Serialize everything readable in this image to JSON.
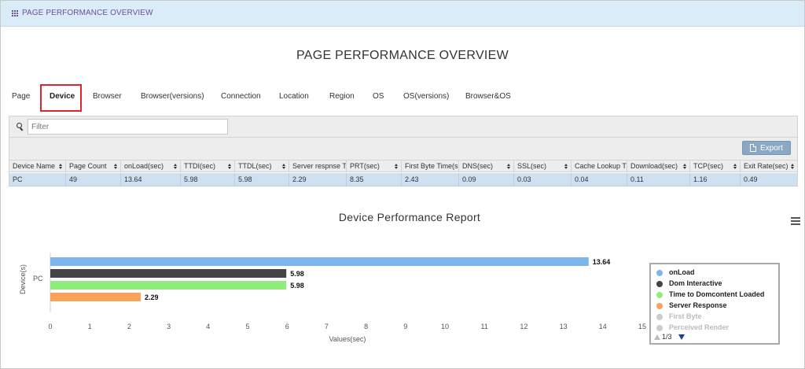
{
  "topbar": {
    "title": "PAGE PERFORMANCE OVERVIEW",
    "icon": "grid-icon"
  },
  "page_title": "PAGE PERFORMANCE OVERVIEW",
  "tabs": [
    {
      "label": "Page",
      "active": false
    },
    {
      "label": "Device",
      "active": true
    },
    {
      "label": "Browser",
      "active": false
    },
    {
      "label": "Browser(versions)",
      "active": false
    },
    {
      "label": "Connection",
      "active": false
    },
    {
      "label": "Location",
      "active": false
    },
    {
      "label": "Region",
      "active": false
    },
    {
      "label": "OS",
      "active": false
    },
    {
      "label": "OS(versions)",
      "active": false
    },
    {
      "label": "Browser&OS",
      "active": false
    }
  ],
  "filter": {
    "placeholder": "Filter",
    "value": ""
  },
  "export_label": "Export",
  "table": {
    "columns": [
      "Device Name",
      "Page Count",
      "onLoad(sec)",
      "TTDI(sec)",
      "TTDL(sec)",
      "Server respnse Ti",
      "PRT(sec)",
      "First Byte Time(se",
      "DNS(sec)",
      "SSL(sec)",
      "Cache Lookup Tir",
      "Download(sec)",
      "TCP(sec)",
      "Exit Rate(sec)"
    ],
    "rows": [
      [
        "PC",
        "49",
        "13.64",
        "5.98",
        "5.98",
        "2.29",
        "8.35",
        "2.43",
        "0.09",
        "0.03",
        "0.04",
        "0.11",
        "1.16",
        "0.49"
      ]
    ]
  },
  "chart_data": {
    "type": "bar",
    "orientation": "horizontal",
    "title": "Device Performance Report",
    "xlabel": "Values(sec)",
    "ylabel": "Device(s)",
    "categories": [
      "PC"
    ],
    "xlim": [
      0,
      15
    ],
    "xticks": [
      0,
      1,
      2,
      3,
      4,
      5,
      6,
      7,
      8,
      9,
      10,
      11,
      12,
      13,
      14,
      15
    ],
    "grid": false,
    "legend_position": "right",
    "series": [
      {
        "name": "onLoad",
        "color": "#7cb5ec",
        "values": [
          13.64
        ],
        "label": "13.64"
      },
      {
        "name": "Dom Interactive",
        "color": "#434348",
        "values": [
          5.98
        ],
        "label": "5.98"
      },
      {
        "name": "Time to Domcontent Loaded",
        "color": "#90ed7d",
        "values": [
          5.98
        ],
        "label": "5.98"
      },
      {
        "name": "Server Response",
        "color": "#f7a35c",
        "values": [
          2.29
        ],
        "label": "2.29"
      }
    ],
    "legend": {
      "items": [
        {
          "name": "onLoad",
          "color": "#7cb5ec",
          "active": true
        },
        {
          "name": "Dom Interactive",
          "color": "#434348",
          "active": true
        },
        {
          "name": "Time to Domcontent Loaded",
          "color": "#90ed7d",
          "active": true
        },
        {
          "name": "Server Response",
          "color": "#f7a35c",
          "active": true
        },
        {
          "name": "First Byte",
          "color": "#cccccc",
          "active": false
        },
        {
          "name": "Perceived Render",
          "color": "#cccccc",
          "active": false
        }
      ],
      "pager": "1/3"
    }
  }
}
